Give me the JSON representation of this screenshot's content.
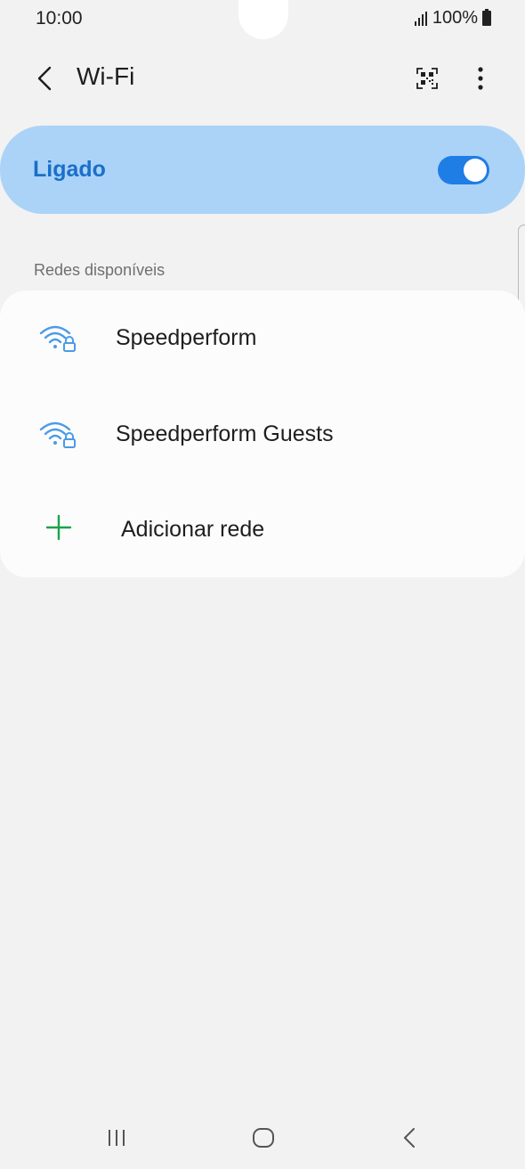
{
  "status_bar": {
    "time": "10:00",
    "battery": "100%",
    "signal_icon": "signal-icon",
    "battery_icon": "battery-icon"
  },
  "app_bar": {
    "title": "Wi-Fi",
    "back_icon": "chevron-left-icon",
    "qr_icon": "qr-code-icon",
    "more_icon": "more-vertical-icon"
  },
  "wifi_toggle": {
    "label": "Ligado",
    "state": "on",
    "accent_color": "#1f7de6",
    "card_color": "#abd3f7"
  },
  "networks": {
    "section_title": "Redes disponíveis",
    "items": [
      {
        "name": "Speedperform",
        "icon": "wifi-locked-icon"
      },
      {
        "name": "Speedperform Guests",
        "icon": "wifi-locked-icon"
      }
    ],
    "add_label": "Adicionar rede",
    "add_icon": "plus-icon",
    "add_icon_color": "#1aa34a"
  },
  "nav_bar": {
    "recents_icon": "recents-icon",
    "home_icon": "home-icon",
    "back_icon": "back-icon"
  }
}
